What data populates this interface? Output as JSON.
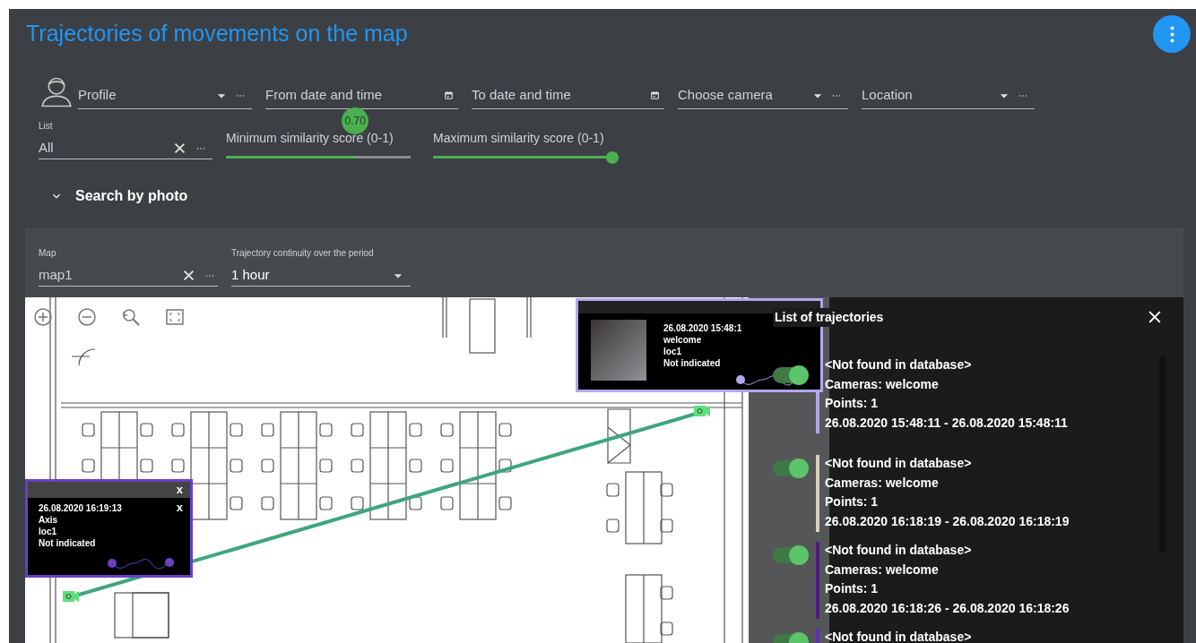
{
  "title": "Trajectories of movements on the map",
  "filters": [
    {
      "kind": "select",
      "placeholder": "Profile",
      "more": true
    },
    {
      "kind": "date",
      "placeholder": "From date and time",
      "more": false
    },
    {
      "kind": "date",
      "placeholder": "To date and time",
      "more": false
    },
    {
      "kind": "select",
      "placeholder": "Choose camera",
      "more": true
    },
    {
      "kind": "select",
      "placeholder": "Location",
      "more": true
    }
  ],
  "list_field": {
    "label": "List",
    "value": "All"
  },
  "sliders": [
    {
      "label": "Minimum similarity score (0-1)",
      "level": 0.7,
      "reading": "0.70"
    },
    {
      "label": "Maximum similarity score (0-1)",
      "level": 1
    }
  ],
  "search_by_photo": {
    "label": "Search by photo",
    "expanded": false
  },
  "map_field": {
    "label": "Map",
    "value": "map1"
  },
  "continuity": {
    "label": "Trajectory continuity over the period",
    "value": "1 hour"
  },
  "popups": [
    {
      "kind": "photo",
      "time": "26.08.2020 15:48:1",
      "camera": "welcome",
      "location": "loc1",
      "note": "Not indicated",
      "color": "#b4a7e8"
    },
    {
      "kind": "text",
      "time": "26.08.2020 16:19:13",
      "camera": "Axis",
      "location": "loc1",
      "note": "Not indicated",
      "color": "#6a3fc4",
      "close_marks": [
        "x",
        "x"
      ]
    }
  ],
  "trajectory_list": {
    "title": "List of trajectories",
    "items": [
      {
        "name": "<Not found in database>",
        "cameras": "Cameras: welcome",
        "points": "Points: 1",
        "period": "26.08.2020 15:48:11 - 26.08.2020 15:48:11",
        "on": true,
        "color": "#b4a7e8"
      },
      {
        "name": "<Not found in database>",
        "cameras": "Cameras: welcome",
        "points": "Points: 1",
        "period": "26.08.2020 16:18:19 - 26.08.2020 16:18:19",
        "on": true,
        "color": "#d8cfc2"
      },
      {
        "name": "<Not found in database>",
        "cameras": "Cameras: welcome",
        "points": "Points: 1",
        "period": "26.08.2020 16:18:26 - 26.08.2020 16:18:26",
        "on": true,
        "color": "#4b1f7d"
      },
      {
        "name": "<Not found in database>",
        "on": true,
        "color": "#5c32a6"
      }
    ]
  }
}
